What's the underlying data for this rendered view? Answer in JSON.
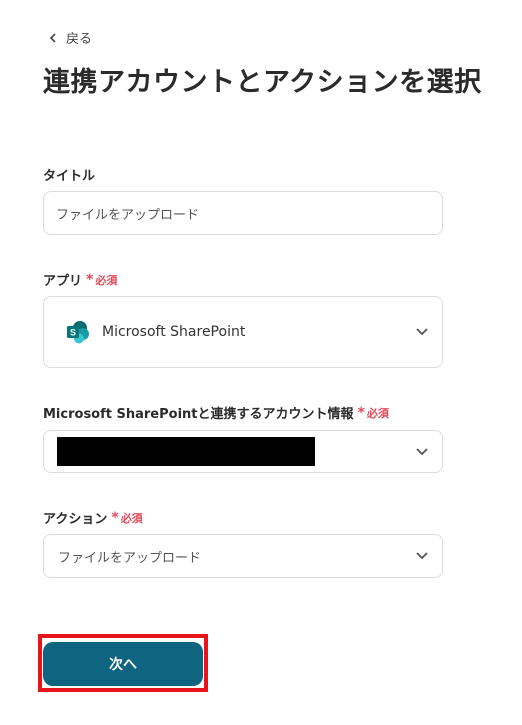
{
  "header": {
    "back_label": "戻る",
    "title": "連携アカウントとアクションを選択"
  },
  "fields": {
    "title_field": {
      "label": "タイトル",
      "value": "ファイルをアップロード"
    },
    "app_field": {
      "label": "アプリ",
      "required": "必須",
      "value": "Microsoft SharePoint",
      "icon": "sharepoint-icon"
    },
    "account_field": {
      "label": "Microsoft SharePointと連携するアカウント情報",
      "required": "必須"
    },
    "action_field": {
      "label": "アクション",
      "required": "必須",
      "value": "ファイルをアップロード"
    }
  },
  "footer": {
    "next_label": "次へ"
  },
  "colors": {
    "primary": "#0f6480",
    "required": "#e24a5c",
    "highlight": "#e8141c"
  }
}
